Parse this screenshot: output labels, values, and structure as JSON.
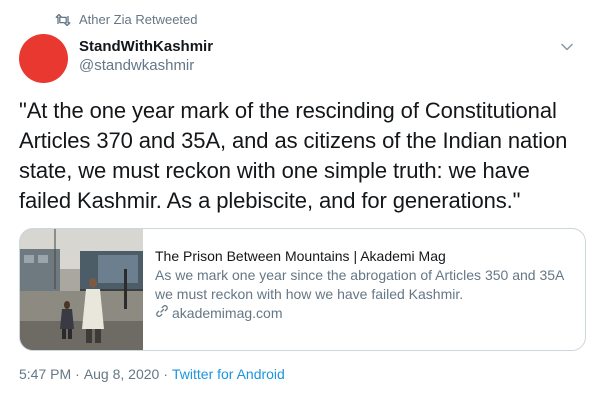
{
  "retweet": {
    "icon": "retweet-icon",
    "label": "Ather Zia Retweeted"
  },
  "author": {
    "avatar_color": "#e8382f",
    "display_name": "StandWithKashmir",
    "handle": "@standwkashmir"
  },
  "tweet": {
    "text": "\"At the one year mark of the rescinding of Constitutional Articles 370 and 35A, and as citizens of the Indian nation state, we must reckon with one simple truth: we have failed Kashmir. As a plebiscite, and for generations.\""
  },
  "card": {
    "title": "The Prison Between Mountains | Akademi Mag",
    "description": "As we mark one year since the abrogation of Articles 350 and 35A we must reckon with how we have failed Kashmir.",
    "link_icon": "link-icon",
    "domain": "akademimag.com"
  },
  "meta": {
    "time": "5:47 PM",
    "separator1": "·",
    "date": "Aug 8, 2020",
    "separator2": "·",
    "source": "Twitter for Android"
  },
  "colors": {
    "link_blue": "#1b95e0",
    "secondary_text": "#657786",
    "border": "#ccd6dd"
  }
}
